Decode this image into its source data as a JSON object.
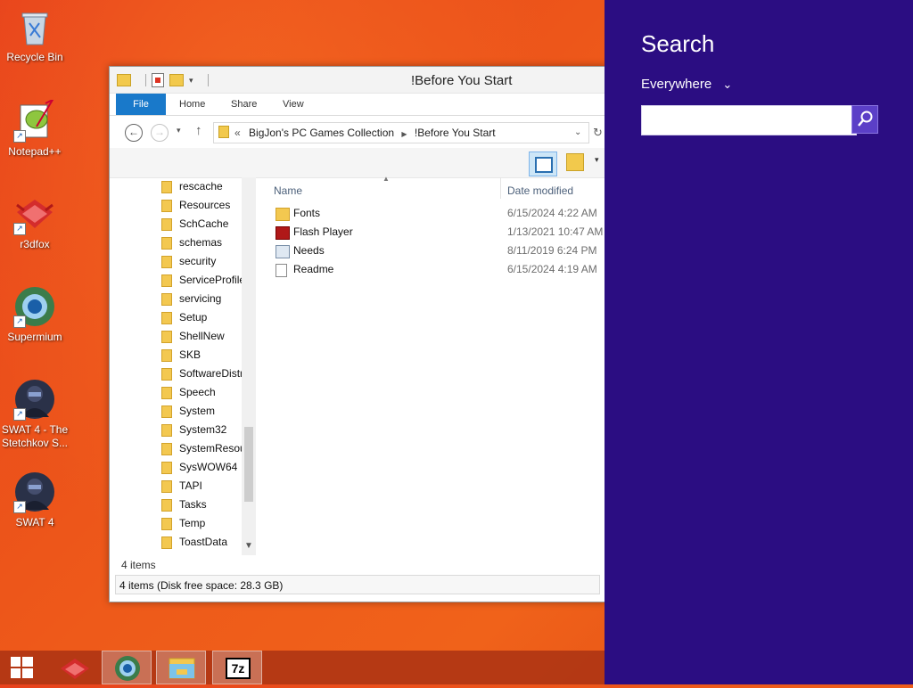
{
  "desktop": {
    "icons": [
      {
        "label": "Recycle Bin",
        "icon": "recycle-bin-icon"
      },
      {
        "label": "Notepad++",
        "icon": "notepad-plus-plus-icon"
      },
      {
        "label": "r3dfox",
        "icon": "r3dfox-icon"
      },
      {
        "label": "Supermium",
        "icon": "supermium-icon"
      },
      {
        "label": "SWAT 4 - The Stetchkov S...",
        "icon": "swat4-expansion-icon"
      },
      {
        "label": "SWAT 4",
        "icon": "swat4-icon"
      }
    ]
  },
  "explorer": {
    "title": "!Before You Start",
    "tabs": {
      "file": "File",
      "home": "Home",
      "share": "Share",
      "view": "View"
    },
    "address": {
      "prefix": "«",
      "crumb1": "BigJon's PC Games Collection",
      "crumb2": "!Before You Start"
    },
    "nav_pane": [
      "rescache",
      "Resources",
      "SchCache",
      "schemas",
      "security",
      "ServiceProfile",
      "servicing",
      "Setup",
      "ShellNew",
      "SKB",
      "SoftwareDistri",
      "Speech",
      "System",
      "System32",
      "SystemResou",
      "SysWOW64",
      "TAPI",
      "Tasks",
      "Temp",
      "ToastData"
    ],
    "columns": {
      "name": "Name",
      "date": "Date modified"
    },
    "files": [
      {
        "name": "Fonts",
        "date": "6/15/2024 4:22 AM",
        "icon": "folder-icon"
      },
      {
        "name": "Flash Player",
        "date": "1/13/2021 10:47 AM",
        "icon": "flash-player-icon"
      },
      {
        "name": "Needs",
        "date": "8/11/2019 6:24 PM",
        "icon": "shortcut-icon"
      },
      {
        "name": "Readme",
        "date": "6/15/2024 4:19 AM",
        "icon": "text-file-icon"
      }
    ],
    "status_count": "4 items",
    "details_bar": "4 items (Disk free space: 28.3 GB)"
  },
  "search_charm": {
    "title": "Search",
    "scope": "Everywhere",
    "input_value": "",
    "colors": {
      "panel": "#2b0d82",
      "button": "#5b3fc7"
    }
  },
  "taskbar": {
    "items": [
      "start-button",
      "r3dfox",
      "supermium",
      "file-explorer",
      "7-zip"
    ],
    "sevenzip_label": "7z"
  }
}
